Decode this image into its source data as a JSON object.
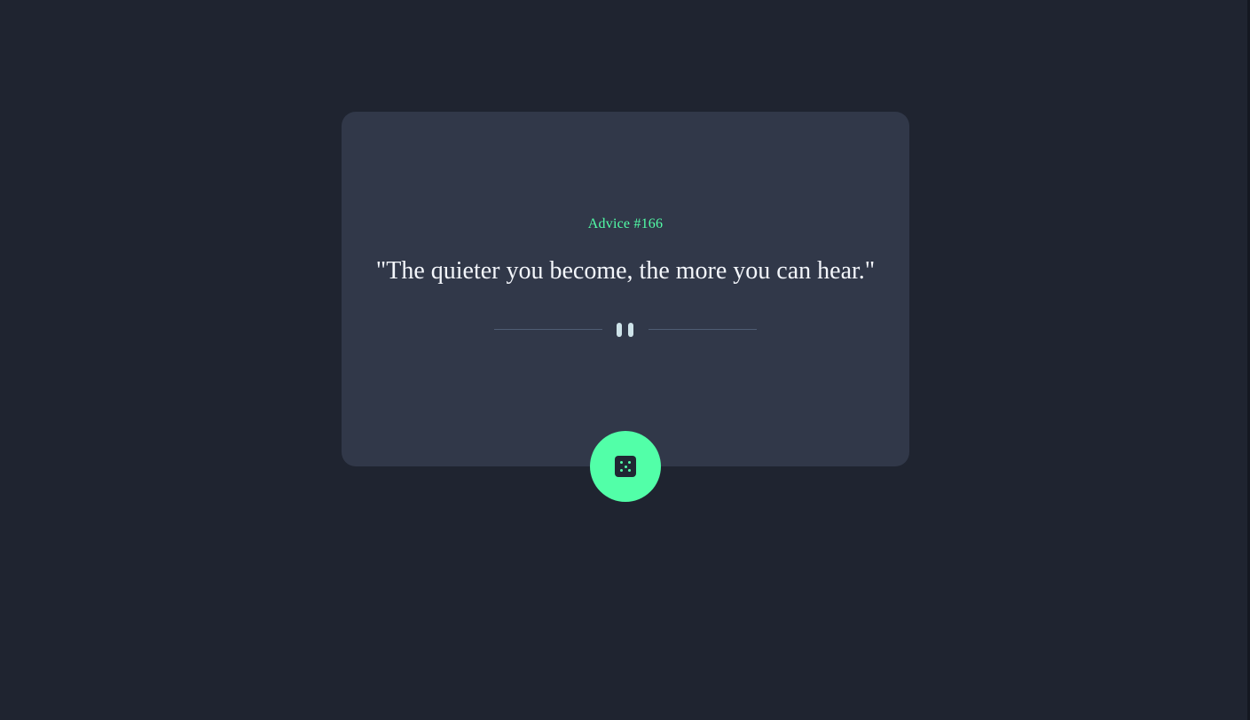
{
  "advice": {
    "id_label": "Advice #166",
    "text": "\"The quieter you become, the more you can hear.\""
  },
  "icons": {
    "divider": "pause-icon",
    "button": "dice-icon"
  },
  "colors": {
    "background": "#1f2430",
    "card": "#313849",
    "accent": "#52ffa8",
    "text": "#f3f6fb",
    "divider": "#4f5d73"
  }
}
